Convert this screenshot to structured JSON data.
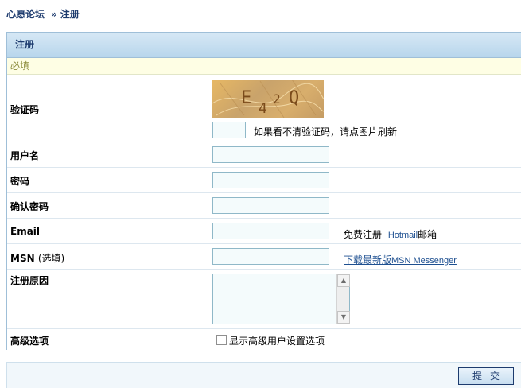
{
  "breadcrumb": {
    "forum_name": "心愿论坛",
    "separator": "»",
    "current": "注册"
  },
  "panel": {
    "title": "注册",
    "required_note": "必填"
  },
  "form": {
    "captcha": {
      "label": "验证码",
      "hint": "如果看不清验证码，请点图片刷新",
      "value": "",
      "image_text": "E42Q"
    },
    "username": {
      "label": "用户名",
      "value": ""
    },
    "password": {
      "label": "密码",
      "value": ""
    },
    "confirm_password": {
      "label": "确认密码",
      "value": ""
    },
    "email": {
      "label": "Email",
      "value": "",
      "hint_prefix": "免费注册",
      "hint_link": "Hotmail",
      "hint_suffix": "邮箱"
    },
    "msn": {
      "label": "MSN",
      "label_note": "(选填)",
      "value": "",
      "hint_prefix": "下载最新版",
      "hint_link": "MSN Messenger"
    },
    "reason": {
      "label": "注册原因",
      "value": ""
    },
    "advanced": {
      "label": "高级选项",
      "checkbox_label": "显示高级用户设置选项",
      "checked": false
    }
  },
  "submit_label": "提交",
  "colors": {
    "header_text": "#1d3b6e",
    "link": "#1d4f90",
    "panel_border": "#9fbfd8",
    "required_bg": "#fefee4"
  }
}
